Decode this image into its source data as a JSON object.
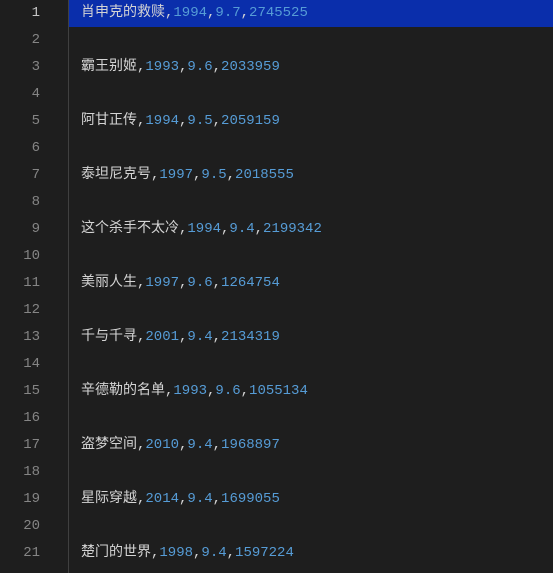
{
  "editor": {
    "line_count": 21,
    "selected_line": 1,
    "lines": [
      {
        "t": "肖申克的救赎",
        "y": "1994",
        "r": "9.7",
        "v": "2745525"
      },
      null,
      {
        "t": "霸王别姬",
        "y": "1993",
        "r": "9.6",
        "v": "2033959"
      },
      null,
      {
        "t": "阿甘正传",
        "y": "1994",
        "r": "9.5",
        "v": "2059159"
      },
      null,
      {
        "t": "泰坦尼克号",
        "y": "1997",
        "r": "9.5",
        "v": "2018555"
      },
      null,
      {
        "t": "这个杀手不太冷",
        "y": "1994",
        "r": "9.4",
        "v": "2199342"
      },
      null,
      {
        "t": "美丽人生",
        "y": "1997",
        "r": "9.6",
        "v": "1264754"
      },
      null,
      {
        "t": "千与千寻",
        "y": "2001",
        "r": "9.4",
        "v": "2134319"
      },
      null,
      {
        "t": "辛德勒的名单",
        "y": "1993",
        "r": "9.6",
        "v": "1055134"
      },
      null,
      {
        "t": "盗梦空间",
        "y": "2010",
        "r": "9.4",
        "v": "1968897"
      },
      null,
      {
        "t": "星际穿越",
        "y": "2014",
        "r": "9.4",
        "v": "1699055"
      },
      null,
      {
        "t": "楚门的世界",
        "y": "1998",
        "r": "9.4",
        "v": "1597224"
      }
    ]
  },
  "separator": ","
}
